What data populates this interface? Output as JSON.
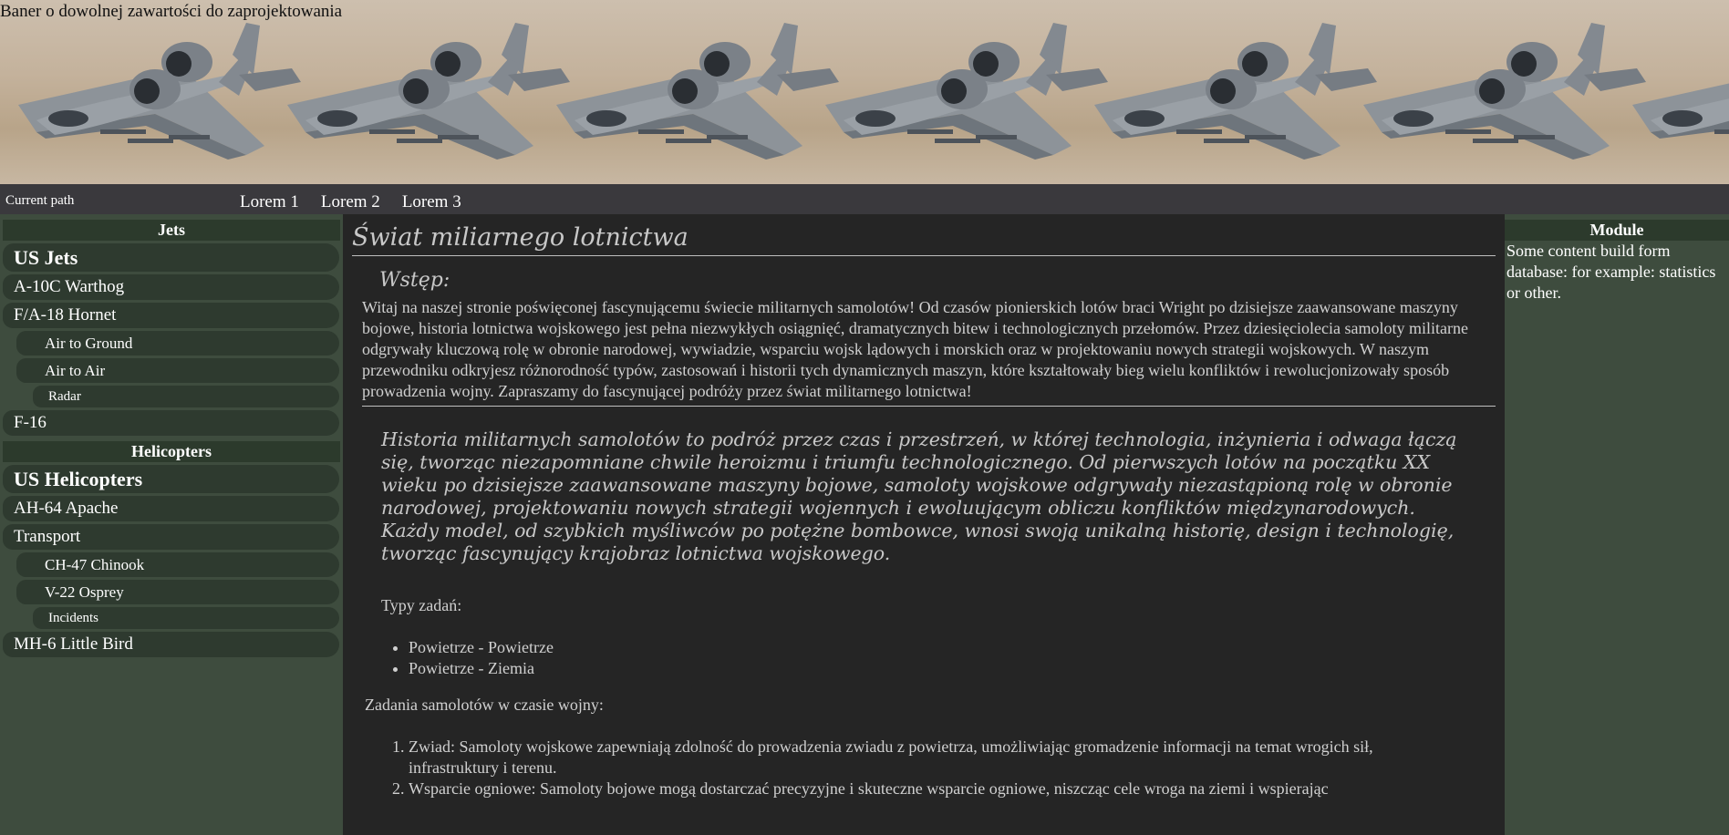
{
  "banner": {
    "title": "Baner o dowolnej zawartości do zaprojektowania",
    "image": "a10-warthog-jet-repeated"
  },
  "navbar": {
    "current_path": "Current path",
    "links": [
      "Lorem 1",
      "Lorem 2",
      "Lorem 3"
    ]
  },
  "sidebar": {
    "jets": {
      "heading": "Jets",
      "items": [
        {
          "label": "US Jets"
        },
        {
          "label": "A-10C Warthog"
        },
        {
          "label": "F/A-18 Hornet"
        },
        {
          "label": "Air to Ground"
        },
        {
          "label": "Air to Air"
        },
        {
          "label": "Radar"
        },
        {
          "label": "F-16"
        }
      ]
    },
    "helicopters": {
      "heading": "Helicopters",
      "items": [
        {
          "label": "US Helicopters"
        },
        {
          "label": "AH-64 Apache"
        },
        {
          "label": "Transport"
        },
        {
          "label": "CH-47 Chinook"
        },
        {
          "label": "V-22 Osprey"
        },
        {
          "label": "Incidents"
        },
        {
          "label": "MH-6 Little Bird"
        }
      ]
    }
  },
  "main": {
    "title": "Świat miliarnego lotnictwa",
    "intro_heading": "Wstęp:",
    "intro_text": "Witaj na naszej stronie poświęconej fascynującemu świecie militarnych samolotów! Od czasów pionierskich lotów braci Wright po dzisiejsze zaawansowane maszyny bojowe, historia lotnictwa wojskowego jest pełna niezwykłych osiągnięć, dramatycznych bitew i technologicznych przełomów. Przez dziesięciolecia samoloty militarne odgrywały kluczową rolę w obronie narodowej, wywiadzie, wsparciu wojsk lądowych i morskich oraz w projektowaniu nowych strategii wojskowych. W naszym przewodniku odkryjesz różnorodność typów, zastosowań i historii tych dynamicznych maszyn, które kształtowały bieg wielu konfliktów i rewolucjonizowały sposób prowadzenia wojny. Zapraszamy do fascynującej podróży przez świat militarnego lotnictwa!",
    "quote": "Historia militarnych samolotów to podróż przez czas i przestrzeń, w której technologia, inżynieria i odwaga łączą się, tworząc niezapomniane chwile heroizmu i triumfu technologicznego. Od pierwszych lotów na początku XX wieku po dzisiejsze zaawansowane maszyny bojowe, samoloty wojskowe odgrywały niezastąpioną rolę w obronie narodowej, projektowaniu nowych strategii wojennych i ewoluującym obliczu konfliktów międzynarodowych. Każdy model, od szybkich myśliwców po potężne bombowce, wnosi swoją unikalną historię, design i technologię, tworząc fascynujący krajobraz lotnictwa wojskowego.",
    "types_label": "Typy zadań:",
    "types": [
      "Powietrze - Powietrze",
      "Powietrze - Ziemia"
    ],
    "tasks_label": "Zadania samolotów w czasie wojny:",
    "tasks": [
      "Zwiad: Samoloty wojskowe zapewniają zdolność do prowadzenia zwiadu z powietrza, umożliwiając gromadzenie informacji na temat wrogich sił, infrastruktury i terenu.",
      "Wsparcie ogniowe: Samoloty bojowe mogą dostarczać precyzyjne i skuteczne wsparcie ogniowe, niszcząc cele wroga na ziemi i wspierając"
    ]
  },
  "module": {
    "heading": "Module",
    "text": "Some content build form database: for example: statistics or other."
  }
}
